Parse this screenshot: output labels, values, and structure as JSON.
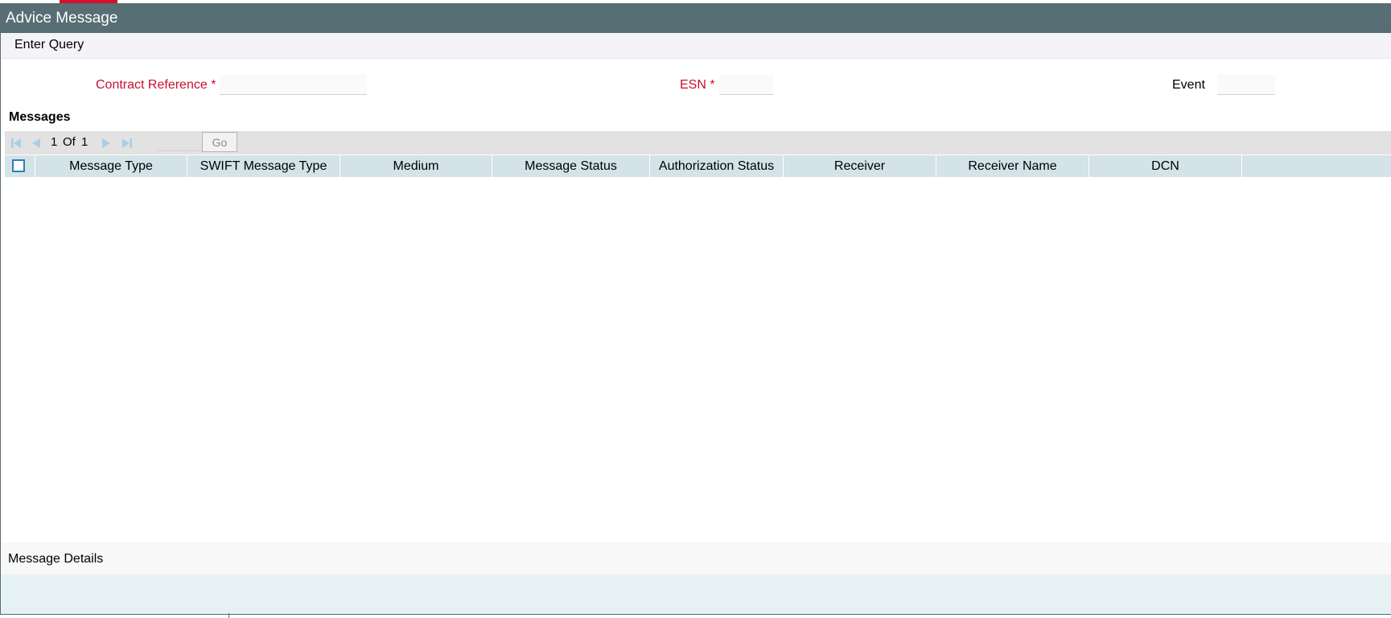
{
  "window": {
    "title": "Advice Message"
  },
  "toolbar": {
    "enter_query_label": "Enter Query"
  },
  "form": {
    "contract_reference": {
      "label": "Contract Reference",
      "required_mark": "*",
      "value": ""
    },
    "esn": {
      "label": "ESN",
      "required_mark": "*",
      "value": ""
    },
    "event": {
      "label": "Event",
      "value": ""
    }
  },
  "messages": {
    "section_title": "Messages",
    "pagination": {
      "current_page": "1",
      "of_label": "Of",
      "total_pages": "1",
      "go_label": "Go"
    },
    "columns": [
      "Message Type",
      "SWIFT Message Type",
      "Medium",
      "Message Status",
      "Authorization Status",
      "Receiver",
      "Receiver Name",
      "DCN"
    ],
    "rows": []
  },
  "details": {
    "label": "Message Details"
  },
  "colors": {
    "titlebar": "#566e74",
    "required_label": "#c8102e",
    "grid_header": "#d3e3e7",
    "pager_icon": "#a9cfe3",
    "checkbox_border": "#2f7fb5"
  },
  "icons": {
    "first_page": "first-page-icon",
    "previous_page": "previous-page-icon",
    "next_page": "next-page-icon",
    "last_page": "last-page-icon"
  }
}
